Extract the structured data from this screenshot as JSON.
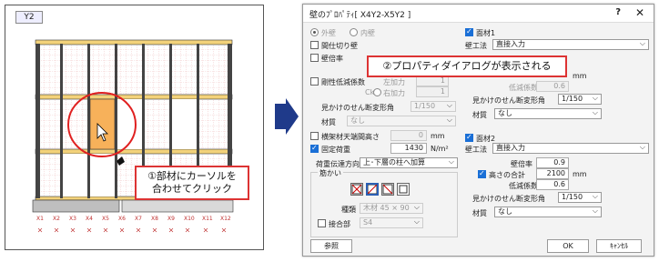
{
  "left": {
    "tab_label": "Y2",
    "callout1": "①部材にカーソルを\n合わせてクリック",
    "callout2": "②プロパティダイアログが表示される",
    "axis_labels": [
      "X1",
      "X2",
      "X3",
      "X4",
      "X5",
      "X6",
      "X7",
      "X8",
      "X9",
      "X10",
      "X11",
      "X12"
    ]
  },
  "dialog": {
    "title": "壁のﾌﾟﾛﾊﾟﾃｨ[ X4Y2-X5Y2 ]",
    "help": "?",
    "close": "✕",
    "outer_wall": "外壁",
    "inner_wall": "内壁",
    "partition_wall": "間仕切り壁",
    "wall_rate": "壁倍率",
    "stiffness_reduction": "剛性低減係数",
    "ck": "Ck",
    "left_force": "左加力",
    "right_force": "右加力",
    "left_force_value": "1",
    "right_force_value": "1",
    "shear_angle_label": "見かけのせん断変形角",
    "shear_angle_value": "1/150",
    "material_label": "材質",
    "material_value": "なし",
    "beam_height": "横架材天端間高さ",
    "beam_height_value": "0",
    "mm": "mm",
    "fixed_load": "固定荷重",
    "fixed_load_value": "1430",
    "n_m2": "N/m²",
    "load_direction_label": "荷重伝達方向",
    "load_direction_value": "上･下層の柱へ加算",
    "brace_group": "筋かい",
    "brace_type_label": "種類",
    "brace_type_value": "木材 45 × 90",
    "joint_label": "接合部",
    "joint_value": "S4",
    "panel1": {
      "title": "面材1",
      "method_label": "壁工法",
      "method_value": "直接入力",
      "reduction": "低減係数",
      "reduction_value": "0.6",
      "mm": "mm",
      "shear_label": "見かけのせん断変形角",
      "shear_value": "1/150",
      "material_label": "材質",
      "material_value": "なし"
    },
    "panel2": {
      "title": "面材2",
      "method_label": "壁工法",
      "method_value": "直接入力",
      "wall_rate_label": "壁倍率",
      "wall_rate_value": "0.9",
      "height_total_label": "高さの合計",
      "height_total_value": "2100",
      "mm": "mm",
      "reduction_label": "低減係数",
      "reduction_value": "0.6",
      "shear_label": "見かけのせん断変形角",
      "shear_value": "1/150",
      "material_label": "材質",
      "material_value": "なし"
    },
    "reference_button": "参照",
    "ok_button": "OK",
    "cancel_button": "ｷｬﾝｾﾙ"
  }
}
